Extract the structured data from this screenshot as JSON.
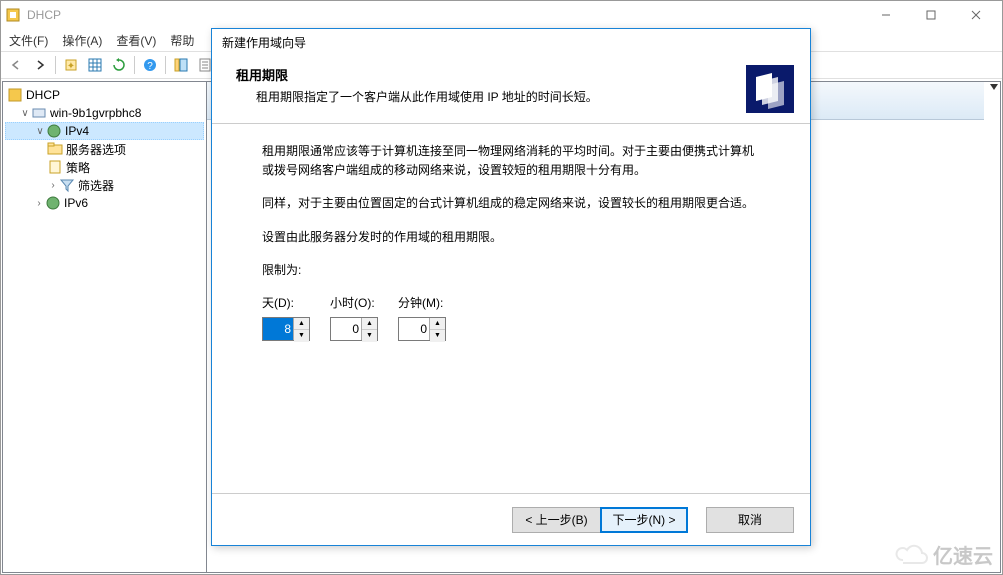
{
  "main_window": {
    "title": "DHCP",
    "menubar": {
      "file": "文件(F)",
      "action": "操作(A)",
      "view": "查看(V)",
      "help": "帮助"
    }
  },
  "tree": {
    "root": "DHCP",
    "server": "win-9b1gvrpbhc8",
    "ipv4": "IPv4",
    "server_options": "服务器选项",
    "policy": "策略",
    "filter": "筛选器",
    "ipv6": "IPv6"
  },
  "wizard": {
    "window_title": "新建作用域向导",
    "header_title": "租用期限",
    "header_desc": "租用期限指定了一个客户端从此作用域使用 IP 地址的时间长短。",
    "body_p1": "租用期限通常应该等于计算机连接至同一物理网络消耗的平均时间。对于主要由便携式计算机或拨号网络客户端组成的移动网络来说，设置较短的租用期限十分有用。",
    "body_p2": "同样，对于主要由位置固定的台式计算机组成的稳定网络来说，设置较长的租用期限更合适。",
    "body_p3": "设置由此服务器分发时的作用域的租用期限。",
    "body_limit": "限制为:",
    "labels": {
      "days": "天(D):",
      "hours": "小时(O):",
      "minutes": "分钟(M):"
    },
    "values": {
      "days": "8",
      "hours": "0",
      "minutes": "0"
    },
    "buttons": {
      "back": "< 上一步(B)",
      "next": "下一步(N) >",
      "cancel": "取消"
    }
  },
  "watermark": "亿速云"
}
